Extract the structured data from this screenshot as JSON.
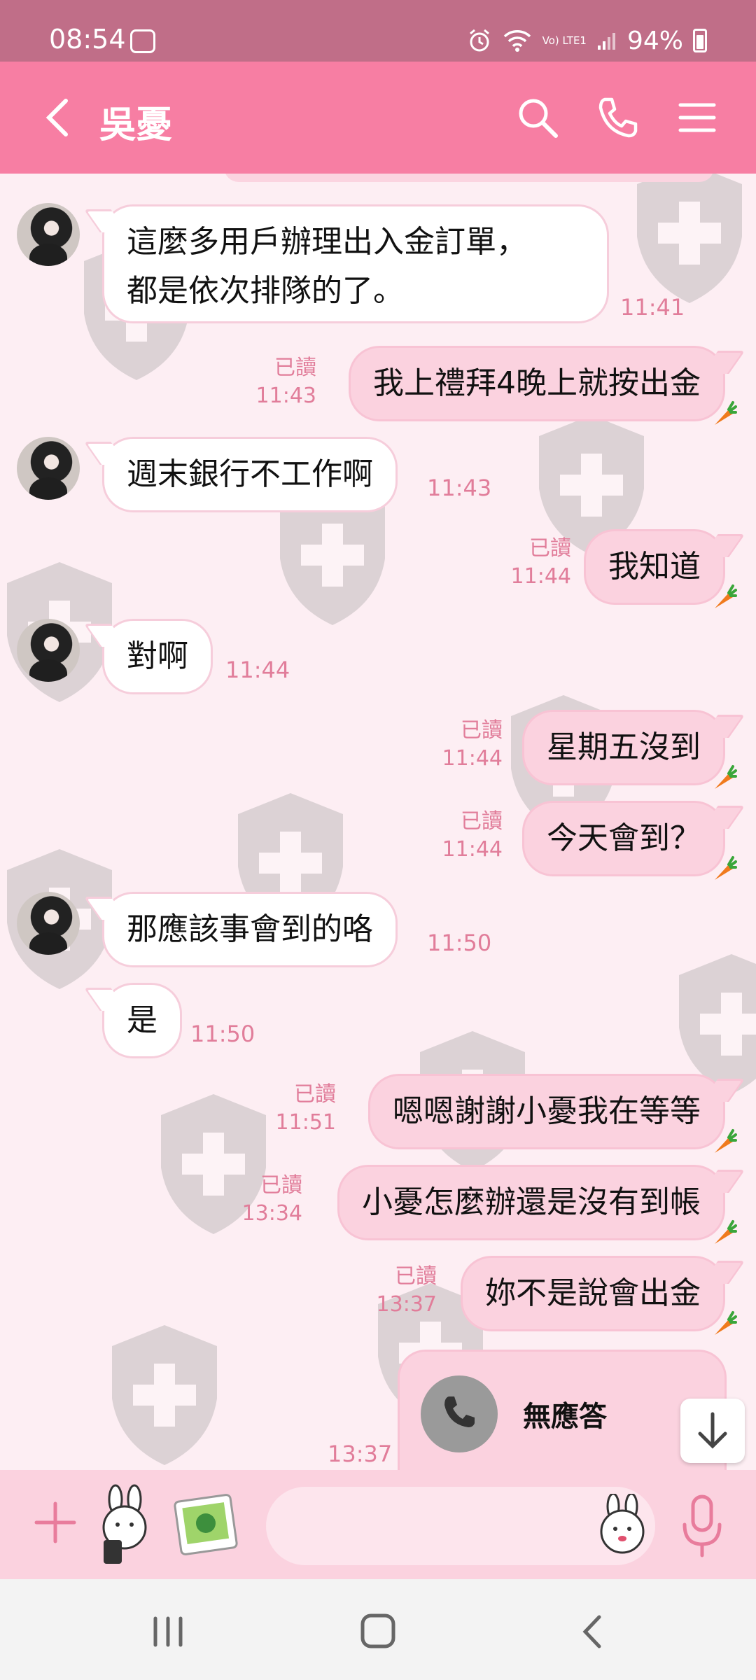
{
  "status_bar": {
    "time": "08:54",
    "battery": "94%",
    "network": "Vo) LTE1"
  },
  "header": {
    "title": "吳憂",
    "back_icon": "chevron-left-icon",
    "search_icon": "search-icon",
    "call_icon": "phone-icon",
    "menu_icon": "hamburger-menu-icon"
  },
  "messages": [
    {
      "direction": "in",
      "text": "這麼多用戶辦理出入金訂單，都是依次排隊的了。",
      "line1": "這麼多用戶辦理出入金訂單，",
      "line2": "都是依次排隊的了。",
      "time": "11:41"
    },
    {
      "direction": "out",
      "text": "我上禮拜4晚上就按出金",
      "read": "已讀",
      "time": "11:43"
    },
    {
      "direction": "in",
      "text": "週末銀行不工作啊",
      "time": "11:43"
    },
    {
      "direction": "out",
      "text": "我知道",
      "read": "已讀",
      "time": "11:44"
    },
    {
      "direction": "in",
      "text": "對啊",
      "time": "11:44"
    },
    {
      "direction": "out",
      "text": "星期五沒到",
      "read": "已讀",
      "time": "11:44"
    },
    {
      "direction": "out",
      "text": "今天會到？",
      "read": "已讀",
      "time": "11:44"
    },
    {
      "direction": "in",
      "text": "那應該事會到的咯",
      "time": "11:50"
    },
    {
      "direction": "in",
      "text": "是",
      "time": "11:50"
    },
    {
      "direction": "out",
      "text": "嗯嗯謝謝小憂我在等等",
      "read": "已讀",
      "time": "11:51"
    },
    {
      "direction": "out",
      "text": "小憂怎麼辦還是沒有到帳",
      "read": "已讀",
      "time": "13:34"
    },
    {
      "direction": "out",
      "text": "妳不是說會出金",
      "read": "已讀",
      "time": "13:37"
    }
  ],
  "call_card": {
    "label": "無應答",
    "time": "13:37",
    "icon": "phone-icon"
  },
  "input_bar": {
    "placeholder": "",
    "plus_icon": "plus-icon",
    "sticker_icon": "sticker-icon",
    "photo_icon": "photo-icon",
    "emoji_icon": "emoji-icon",
    "mic_icon": "microphone-icon"
  },
  "colors": {
    "status_bar": "#c06e88",
    "header": "#f77ea3",
    "chat_bg": "#fdeef3",
    "outgoing_bubble": "#fbd2df",
    "incoming_bubble": "#ffffff",
    "timestamp": "#e17d9a"
  }
}
